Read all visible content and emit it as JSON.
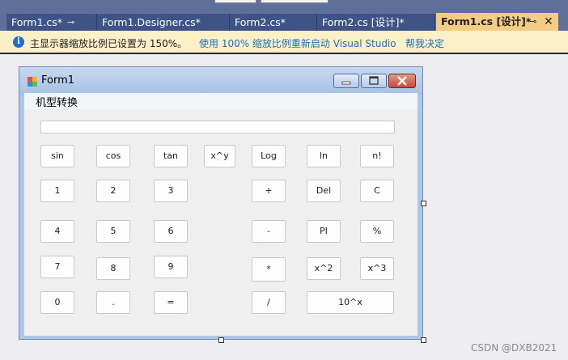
{
  "tabs": [
    {
      "label": "Form1.cs*",
      "pin": "⮦",
      "close": ""
    },
    {
      "label": "Form1.Designer.cs*",
      "pin": "",
      "close": ""
    },
    {
      "label": "Form2.cs*",
      "pin": "",
      "close": ""
    },
    {
      "label": "Form2.cs [设计]*",
      "pin": "",
      "close": ""
    },
    {
      "label": "Form1.cs [设计]*",
      "pin": "⊸",
      "close": "✕"
    }
  ],
  "infobar": {
    "message": "主显示器缩放比例已设置为 150%。",
    "restart_link": "使用 100% 缩放比例重新启动 Visual Studio",
    "help_link": "帮我决定",
    "icon": "info-icon"
  },
  "form": {
    "title": "Form1",
    "menu": "机型转换",
    "textbox_value": "",
    "buttons": [
      "sin",
      "cos",
      "tan",
      "x^y",
      "Log",
      "ln",
      "n!",
      "1",
      "2",
      "3",
      "+",
      "Del",
      "C",
      "4",
      "5",
      "6",
      "-",
      "PI",
      "%",
      "7",
      "8",
      "9",
      "*",
      "x^2",
      "x^3",
      "0",
      ".",
      "=",
      "/",
      "10^x"
    ]
  },
  "watermark": "CSDN @DXB2021",
  "colors": {
    "accent_tab": "#f5cc84",
    "tab_bg": "#3f5386",
    "info_bg": "#fbf0c8",
    "link": "#1a6fb8"
  }
}
